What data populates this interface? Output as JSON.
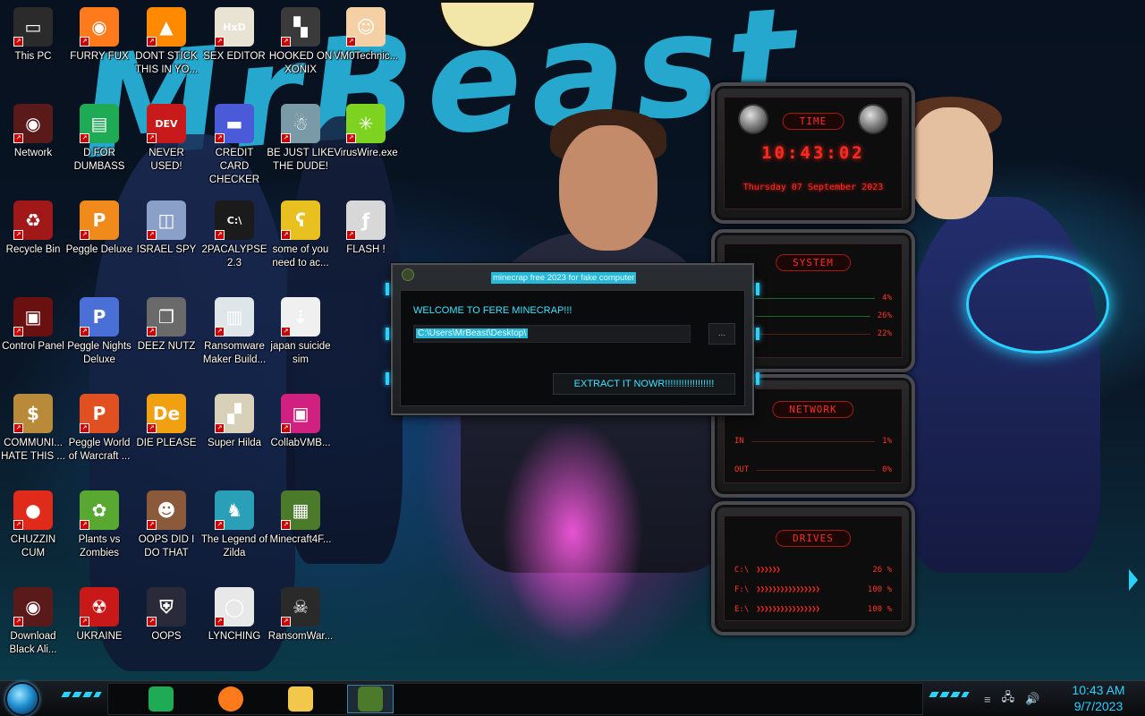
{
  "desktop": {
    "wallpaper_text": "MrBeast",
    "icons": [
      {
        "label": "This PC",
        "icon": "computer-icon",
        "bg": "#2b2b2b",
        "glyph": "▭",
        "col": 0,
        "row": 0
      },
      {
        "label": "FURRY FUX",
        "icon": "firefox-icon",
        "bg": "#ff7a1a",
        "glyph": "◉",
        "col": 1,
        "row": 0
      },
      {
        "label": "DONT STICK THIS IN YO...",
        "icon": "vlc-cone-icon",
        "bg": "#ff8a00",
        "glyph": "▲",
        "col": 2,
        "row": 0
      },
      {
        "label": "SEX EDITOR",
        "icon": "hxd-editor-icon",
        "bg": "#e8e3d2",
        "glyph": "HxD",
        "col": 3,
        "row": 0
      },
      {
        "label": "HOOKED ON XONIX",
        "icon": "xonix-game-icon",
        "bg": "#3a3a3a",
        "glyph": "▚",
        "col": 4,
        "row": 0
      },
      {
        "label": "VM0Technic...",
        "icon": "doctor-icon",
        "bg": "#f4d0a4",
        "glyph": "☺",
        "col": 5,
        "row": 0
      },
      {
        "label": "Network",
        "icon": "network-icon",
        "bg": "#5a1a1a",
        "glyph": "◉",
        "col": 0,
        "row": 1
      },
      {
        "label": "D FOR DUMBASS",
        "icon": "sheets-icon",
        "bg": "#1faa55",
        "glyph": "▤",
        "col": 1,
        "row": 1
      },
      {
        "label": "NEVER USED!",
        "icon": "devcpp-icon",
        "bg": "#c81a1a",
        "glyph": "DEV",
        "col": 2,
        "row": 1
      },
      {
        "label": "CREDIT CARD CHECKER",
        "icon": "credit-card-icon",
        "bg": "#4a5ad8",
        "glyph": "▬",
        "col": 3,
        "row": 1
      },
      {
        "label": "BE JUST LIKE THE DUDE!",
        "icon": "santa-icon",
        "bg": "#7a9aa8",
        "glyph": "☃",
        "col": 4,
        "row": 1
      },
      {
        "label": "VirusWire.exe",
        "icon": "lime-icon",
        "bg": "#7ed321",
        "glyph": "✳",
        "col": 5,
        "row": 1
      },
      {
        "label": "Recycle Bin",
        "icon": "recycle-bin-icon",
        "bg": "#a01818",
        "glyph": "♻",
        "col": 0,
        "row": 2
      },
      {
        "label": "Peggle Deluxe",
        "icon": "peggle-icon",
        "bg": "#f08a1a",
        "glyph": "P",
        "col": 1,
        "row": 2
      },
      {
        "label": "ISRAEL SPY",
        "icon": "spy-window-icon",
        "bg": "#8aa0c8",
        "glyph": "◫",
        "col": 2,
        "row": 2
      },
      {
        "label": "2PACALYPSE 2.3",
        "icon": "cmd-window-icon",
        "bg": "#1b1b1b",
        "glyph": "C:\\",
        "col": 3,
        "row": 2
      },
      {
        "label": "some of you need to ac...",
        "icon": "bear-icon",
        "bg": "#e8c020",
        "glyph": "ʕ",
        "col": 4,
        "row": 2
      },
      {
        "label": "FLASH !",
        "icon": "flash-icon",
        "bg": "#d8d8d8",
        "glyph": "ƒ",
        "col": 5,
        "row": 2
      },
      {
        "label": "Control Panel",
        "icon": "control-panel-icon",
        "bg": "#6a1010",
        "glyph": "▣",
        "col": 0,
        "row": 3
      },
      {
        "label": "Peggle Nights Deluxe",
        "icon": "peggle-nights-icon",
        "bg": "#4a70d8",
        "glyph": "P",
        "col": 1,
        "row": 3
      },
      {
        "label": "DEEZ NUTZ",
        "icon": "stacked-windows-icon",
        "bg": "#6a6a6a",
        "glyph": "❐",
        "col": 2,
        "row": 3
      },
      {
        "label": "Ransomware Maker Build...",
        "icon": "ransomware-window-icon",
        "bg": "#dfe6ea",
        "glyph": "▥",
        "col": 3,
        "row": 3
      },
      {
        "label": "japan suicide sim",
        "icon": "document-icon",
        "bg": "#f0f0f0",
        "glyph": "⇣",
        "col": 4,
        "row": 3
      },
      {
        "label": "COMMUNI... HATE THIS ...",
        "icon": "money-bag-icon",
        "bg": "#b88a3a",
        "glyph": "$",
        "col": 0,
        "row": 4
      },
      {
        "label": "Peggle World of Warcraft ...",
        "icon": "peggle-wow-icon",
        "bg": "#e05020",
        "glyph": "P",
        "col": 1,
        "row": 4
      },
      {
        "label": "DIE PLEASE",
        "icon": "de-icon",
        "bg": "#f0a010",
        "glyph": "De",
        "col": 2,
        "row": 4
      },
      {
        "label": "Super Hilda",
        "icon": "pixel-art-icon",
        "bg": "#d8d0b8",
        "glyph": "▞",
        "col": 3,
        "row": 4
      },
      {
        "label": "CollabVMB...",
        "icon": "monitor-icon",
        "bg": "#d02080",
        "glyph": "▣",
        "col": 4,
        "row": 4
      },
      {
        "label": "CHUZZIN CUM",
        "icon": "chuzzle-icon",
        "bg": "#e02a1a",
        "glyph": "●",
        "col": 0,
        "row": 5
      },
      {
        "label": "Plants vs Zombies",
        "icon": "plant-icon",
        "bg": "#58a832",
        "glyph": "✿",
        "col": 1,
        "row": 5
      },
      {
        "label": "OOPS DID I DO THAT",
        "icon": "portrait-icon",
        "bg": "#8a5a3a",
        "glyph": "☻",
        "col": 2,
        "row": 5
      },
      {
        "label": "The Legend of Zilda",
        "icon": "pixel-hero-icon",
        "bg": "#2aa0b8",
        "glyph": "♞",
        "col": 3,
        "row": 5
      },
      {
        "label": "Minecraft4F...",
        "icon": "minecraft-block-icon",
        "bg": "#4a7a2a",
        "glyph": "▦",
        "col": 4,
        "row": 5
      },
      {
        "label": "Download Black Ali...",
        "icon": "alienware-icon",
        "bg": "#5a1a1a",
        "glyph": "◉",
        "col": 0,
        "row": 6
      },
      {
        "label": "UKRAINE",
        "icon": "radiation-icon",
        "bg": "#c81818",
        "glyph": "☢",
        "col": 1,
        "row": 6
      },
      {
        "label": "OOPS",
        "icon": "shield-icon",
        "bg": "#2a2a3a",
        "glyph": "⛨",
        "col": 2,
        "row": 6
      },
      {
        "label": "LYNCHING",
        "icon": "rope-icon",
        "bg": "#e8e8e8",
        "glyph": "◯",
        "col": 3,
        "row": 6
      },
      {
        "label": "RansomWar...",
        "icon": "skull-icon",
        "bg": "#2a2a2a",
        "glyph": "☠",
        "col": 4,
        "row": 6
      }
    ]
  },
  "gadgets": {
    "time": {
      "title": "TIME",
      "time": "10:43:02",
      "date": "Thursday 07 September 2023"
    },
    "system": {
      "title": "SYSTEM",
      "rows": [
        {
          "label": "",
          "value": "4%"
        },
        {
          "label": "",
          "value": "26%"
        },
        {
          "label": "",
          "value": "22%"
        }
      ]
    },
    "network": {
      "title": "NETWORK",
      "rows": [
        {
          "label": "IN",
          "value": "1%"
        },
        {
          "label": "OUT",
          "value": "0%"
        }
      ]
    },
    "drives": {
      "title": "DRIVES",
      "rows": [
        {
          "label": "C:\\",
          "value": "26 %"
        },
        {
          "label": "F:\\",
          "value": "100 %"
        },
        {
          "label": "E:\\",
          "value": "100 %"
        }
      ]
    }
  },
  "dialog": {
    "title": "minecrap free 2023 for fake computer",
    "welcome": "WELCOME TO FERE MINECRAP!!!",
    "path": "C:\\Users\\MrBeast\\Desktop\\",
    "browse_label": "...",
    "extract_label": "EXTRACT IT NOWR!!!!!!!!!!!!!!!!!!"
  },
  "taskbar": {
    "apps": [
      {
        "name": "sheets-taskbar-icon",
        "color": "#1faa55",
        "active": false
      },
      {
        "name": "firefox-taskbar-icon",
        "color": "#ff7a1a",
        "active": false
      },
      {
        "name": "file-explorer-taskbar-icon",
        "color": "#f2c84a",
        "active": false
      },
      {
        "name": "minecraft-taskbar-icon",
        "color": "#4a7a2a",
        "active": true
      }
    ],
    "clock_time": "10:43 AM",
    "clock_date": "9/7/2023",
    "tray_icons": [
      "network-tray-icon",
      "volume-tray-icon"
    ]
  }
}
